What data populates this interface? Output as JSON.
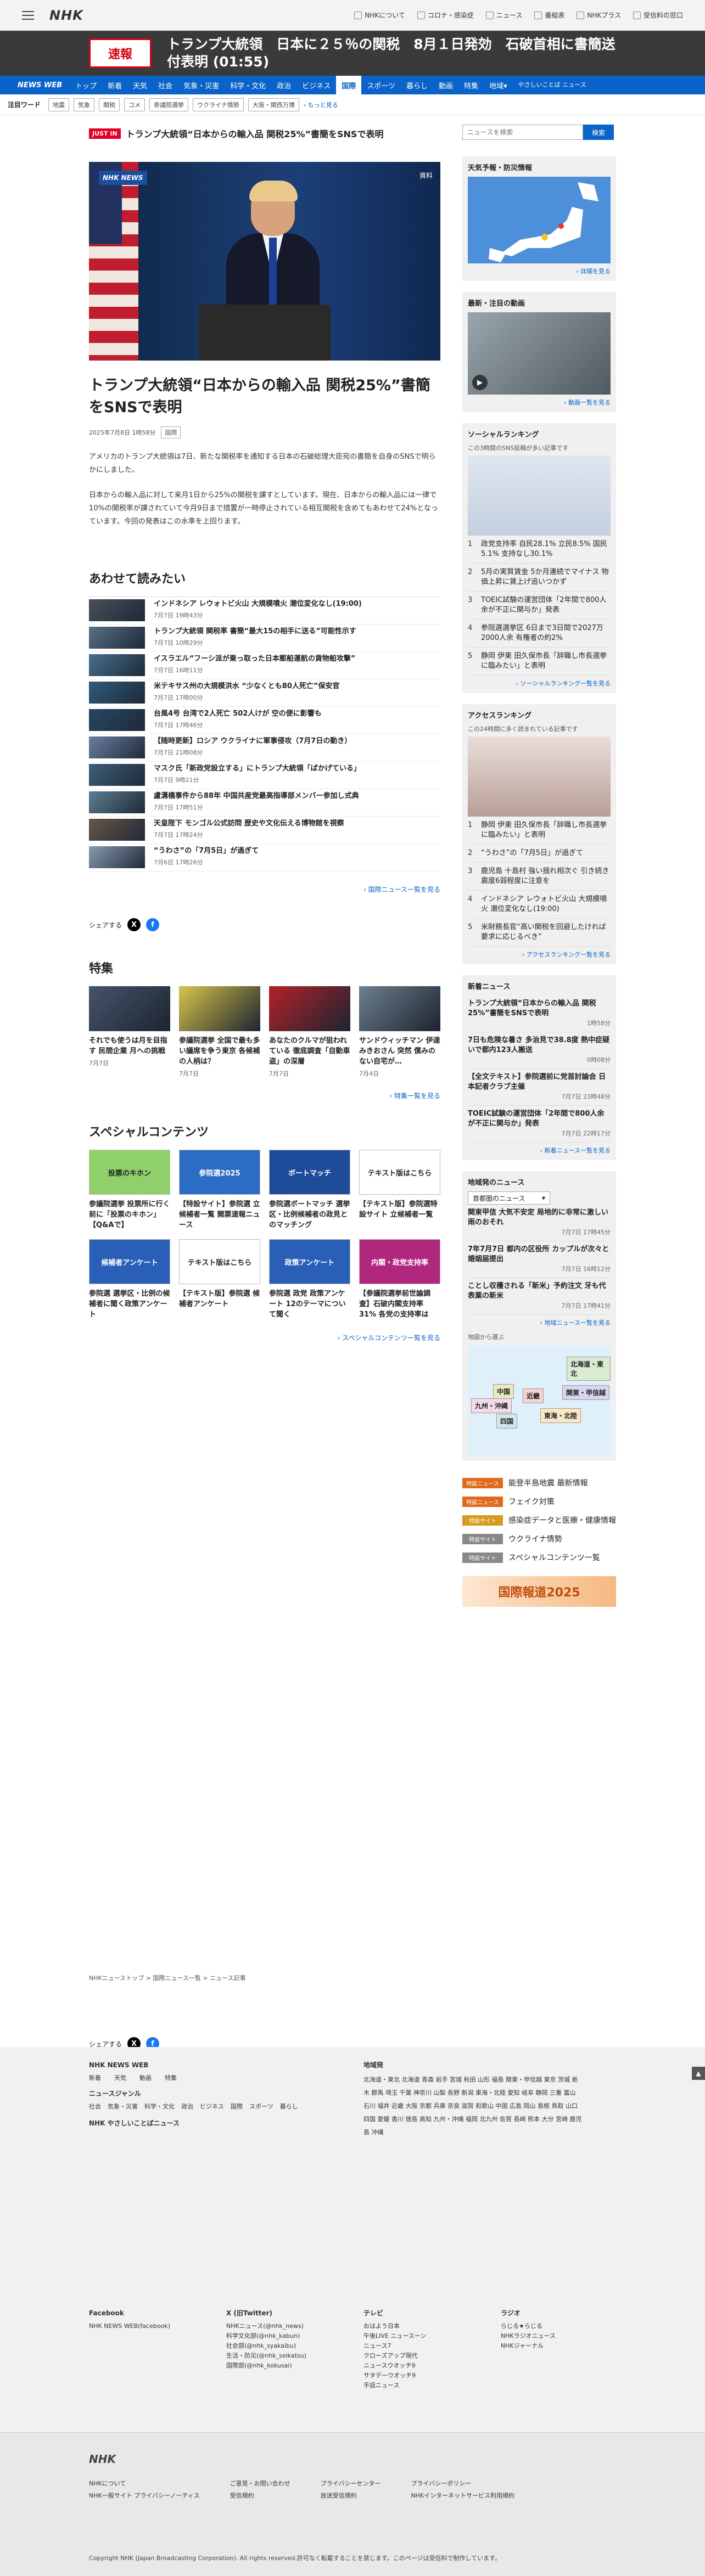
{
  "header": {
    "logo": "NHK",
    "links": [
      {
        "label": "NHKについて",
        "icon": "nhk-icon"
      },
      {
        "label": "コロナ・感染症",
        "icon": "virus-icon"
      },
      {
        "label": "ニュース",
        "icon": "news-icon"
      },
      {
        "label": "番組表",
        "icon": "tv-icon"
      },
      {
        "label": "NHKプラス",
        "icon": "play-icon"
      },
      {
        "label": "受信料の窓口",
        "icon": "yen-icon"
      }
    ]
  },
  "breaking": {
    "badge": "速報",
    "text": "トランプ大統領　日本に２５％の関税　8月１日発効　石破首相に書簡送付表明 (01:55)"
  },
  "nav": {
    "brand": "NEWS WEB",
    "items": [
      "トップ",
      "新着",
      "天気",
      "社会",
      "気象・災害",
      "科学・文化",
      "政治",
      "ビジネス",
      "国際",
      "スポーツ",
      "暮らし",
      "動画",
      "特集",
      "地域"
    ],
    "active": "国際",
    "region_suffix": "▾",
    "easy": "やさしいことば ニュース"
  },
  "keywords": {
    "label": "注目ワード",
    "tags": [
      "地震",
      "気象",
      "関税",
      "コメ",
      "参議院選挙",
      "ウクライナ情勢",
      "大阪・関西万博"
    ],
    "more": "もっと見る"
  },
  "article": {
    "justin_badge": "JUST IN",
    "justin_text": "トランプ大統領“日本からの輸入品 関税25%”書簡をSNSで表明",
    "image_label": "資料",
    "nhk_badge": "NHK NEWS",
    "title": "トランプ大統領“日本からの輸入品 関税25%”書簡をSNSで表明",
    "datetime": "2025年7月8日 1時58分",
    "genre": "国際",
    "paragraphs": [
      "アメリカのトランプ大統領は7日、新たな関税率を通知する日本の石破総理大臣宛の書簡を自身のSNSで明らかにしました。",
      "日本からの輸入品に対して来月1日から25%の関税を課すとしています。現在、日本からの輸入品には一律で10%の関税率が課されていて今月9日まで措置が一時停止されている相互関税を含めてもあわせて24%となっています。今回の発表はこの水準を上回ります。"
    ]
  },
  "related": {
    "heading": "あわせて読みたい",
    "items": [
      {
        "title": "インドネシア レウォトビ火山 大規模噴火 潮位変化なし(19:00)",
        "date": "7月7日 19時43分"
      },
      {
        "title": "トランプ大統領 関税率 書簡“最大15の相手に送る”可能性示す",
        "date": "7月7日 10時29分"
      },
      {
        "title": "イスラエル“フーシ派が乗っ取った日本郵船運航の貨物船攻撃”",
        "date": "7月7日 16時11分"
      },
      {
        "title": "米テキサス州の大規模洪水 “少なくとも80人死亡”保安官",
        "date": "7月7日 17時00分"
      },
      {
        "title": "台風4号 台湾で2人死亡 502人けが 空の便に影響も",
        "date": "7月7日 17時46分"
      },
      {
        "title": "【随時更新】ロシア ウクライナに軍事侵攻（7月7日の動き）",
        "date": "7月7日 21時08分"
      },
      {
        "title": "マスク氏「新政党設立する」にトランプ大統領「ばかげている」",
        "date": "7月7日 9時21分"
      },
      {
        "title": "盧溝橋事件から88年 中国共産党最高指導部メンバー参加し式典",
        "date": "7月7日 17時51分"
      },
      {
        "title": "天皇陛下 モンゴル公式訪問 歴史や文化伝える博物館を視察",
        "date": "7月7日 17時24分"
      },
      {
        "title": "“うわさ”の「7月5日」が過ぎて",
        "date": "7月6日 17時26分"
      }
    ],
    "more": "国際ニュース一覧を見る"
  },
  "share": {
    "label": "シェアする"
  },
  "features": {
    "heading": "特集",
    "items": [
      {
        "title": "それでも使うは月を目指す 民間企業 月への挑戦",
        "date": "7月7日"
      },
      {
        "title": "参議院選挙 全国で最も多い議席を争う東京 各候補の人柄は？",
        "date": "7月7日"
      },
      {
        "title": "あなたのクルマが狙われている 徹底調査「自動車盗」の深層",
        "date": "7月7日"
      },
      {
        "title": "サンドウィッチマン 伊達みきおさん 突然 僕みのない自宅が…",
        "date": "7月4日"
      }
    ],
    "more": "特集一覧を見る"
  },
  "special": {
    "heading": "スペシャルコンテンツ",
    "items": [
      {
        "title": "参議院選挙 投票所に行く前に「投票のキホン」【Q&Aで】",
        "img_text": "投票のキホン"
      },
      {
        "title": "【特設サイト】参院選 立候補者一覧 開票速報ニュース",
        "img_text": "参院選2025"
      },
      {
        "title": "参院選ボートマッチ 選挙区・比例候補者の政見とのマッチング",
        "img_text": "ボートマッチ"
      },
      {
        "title": "【テキスト版】参院選特設サイト 立候補者一覧",
        "img_text": "テキスト版はこちら"
      },
      {
        "title": "参院選 選挙区・比例の候補者に聞く政策アンケート",
        "img_text": "候補者アンケート"
      },
      {
        "title": "【テキスト版】参院選 候補者アンケート",
        "img_text": "テキスト版はこちら"
      },
      {
        "title": "参院選 政党 政策アンケート 12のテーマについて聞く",
        "img_text": "政策アンケート"
      },
      {
        "title": "【参議院選挙前世論調査】石破内閣支持率31% 各党の支持率は",
        "img_text": "内閣・政党支持率"
      }
    ],
    "more": "スペシャルコンテンツ一覧を見る"
  },
  "sidebar": {
    "search_placeholder": "ニュースを検索",
    "search_button": "検索",
    "weather": {
      "heading": "天気予報・防災情報",
      "link": "詳細を見る"
    },
    "video": {
      "heading": "最新・注目の動画",
      "link": "動画一覧を見る"
    },
    "social": {
      "heading": "ソーシャルランキング",
      "caption": "この3時間のSNS投稿が多い記事です",
      "items": [
        "政党支持率 自民28.1% 立民8.5% 国民5.1% 支持なし30.1%",
        "5月の実質賃金 5か月連続でマイナス 物価上昇に賃上げ追いつかず",
        "TOEIC試験の運営団体「2年間で800人余が不正に関与か」発表",
        "参院選選挙区 6日まで3日間で2027万2000人余 有権者の約2%",
        "静岡 伊東 田久保市長「辞職し市長選挙に臨みたい」と表明"
      ],
      "link": "ソーシャルランキング一覧を見る"
    },
    "access": {
      "heading": "アクセスランキング",
      "caption": "この24時間に多く読まれている記事です",
      "items": [
        "静岡 伊東 田久保市長「辞職し市長選挙に臨みたい」と表明",
        "“うわさ”の「7月5日」が過ぎて",
        "鹿児島 十島村 強い揺れ相次ぐ 引き続き震度6弱程度に注意を",
        "インドネシア レウォトビ火山 大規模噴火 潮位変化なし(19:00)",
        "米財務長官“高い関税を回避したければ要求に応じるべき”"
      ],
      "link": "アクセスランキング一覧を見る"
    },
    "latest": {
      "heading": "新着ニュース",
      "items": [
        {
          "title": "トランプ大統領“日本からの輸入品 関税25%”書簡をSNSで表明",
          "date": "1時58分"
        },
        {
          "title": "7日も危険な暑さ 多治見で38.8度 熱中症疑いで都内123人搬送",
          "date": "0時08分"
        },
        {
          "title": "【全文テキスト】参院選前に党首討論会 日本記者クラブ主催",
          "date": "7月7日 23時48分"
        },
        {
          "title": "TOEIC試験の運営団体「2年間で800人余が不正に関与か」発表",
          "date": "7月7日 22時17分"
        }
      ],
      "link": "新着ニュース一覧を見る"
    },
    "local": {
      "heading": "地域発のニュース",
      "region": "首都圏のニュース",
      "items": [
        {
          "title": "関東甲信 大気不安定 局地的に非常に激しい雨のおそれ",
          "date": "7月7日 17時45分"
        },
        {
          "title": "7年7月7日 都内の区役所 カップルが次々と婚姻届提出",
          "date": "7月7日 16時12分"
        },
        {
          "title": "ことし収穫される「新米」予約注文 牙も代表業の新米",
          "date": "7月7日 17時41分"
        }
      ],
      "link": "地域ニュース一覧を見る",
      "map_caption": "地図から選ぶ",
      "regions": [
        "北海道・東北",
        "関東・甲信越",
        "東海・北陸",
        "近畿",
        "中国",
        "四国",
        "九州・沖縄"
      ]
    },
    "tags": [
      {
        "badge": "特設ニュース",
        "label": "能登半島地震 最新情報",
        "color": "#e06a1c"
      },
      {
        "badge": "特設ニュース",
        "label": "フェイク対策",
        "color": "#e06a1c"
      },
      {
        "badge": "特設サイト",
        "label": "感染症データと医療・健康情報",
        "color": "#d69b1e"
      },
      {
        "badge": "特設サイト",
        "label": "ウクライナ情勢",
        "color": "#888888"
      },
      {
        "badge": "特設サイト",
        "label": "スペシャルコンテンツ一覧",
        "color": "#888888"
      }
    ],
    "banner": "国際報道2025"
  },
  "breadcrumbs": [
    "NHKニューストップ",
    "国際ニュース一覧",
    "ニュース記事"
  ],
  "footer": {
    "brand": "NHK NEWS WEB",
    "main_links": [
      "新着",
      "天気",
      "動画",
      "特集"
    ],
    "genre_heading": "ニュースジャンル",
    "genres": [
      "社会",
      "気象・災害",
      "科学・文化",
      "政治",
      "ビジネス",
      "国際",
      "スポーツ",
      "暮らし"
    ],
    "easy": "NHK やさしいことばニュース",
    "region_heading": "地域発",
    "regions": "北海道・東北 北海道 青森 岩手 宮城 秋田 山形 福島 関東・甲信越 東京 茨城 栃木 群馬 埼玉 千葉 神奈川 山梨 長野 新潟 東海・北陸 愛知 岐阜 静岡 三重 富山 石川 福井 近畿 大阪 京都 兵庫 奈良 滋賀 和歌山 中国 広島 岡山 島根 鳥取 山口 四国 愛媛 香川 徳島 高知 九州・沖縄 福岡 北九州 佐賀 長崎 熊本 大分 宮崎 鹿児島 沖縄",
    "sns": [
      {
        "heading": "Facebook",
        "lines": [
          "NHK NEWS WEB(facebook)"
        ]
      },
      {
        "heading": "X (旧Twitter)",
        "lines": [
          "NHKニュース(@nhk_news)",
          "科学文化部(@nhk_kabun)",
          "社会部(@nhk_syakaibu)",
          "生活・防災(@nhk_seikatsu)",
          "国際部(@nhk_kokusai)"
        ]
      },
      {
        "heading": "テレビ",
        "lines": [
          "おはよう日本",
          "午後LIVE ニュースーン",
          "ニュース7",
          "クローズアップ現代",
          "ニュースウオッチ9",
          "サタデーウオッチ9",
          "手話ニュース"
        ]
      },
      {
        "heading": "ラジオ",
        "lines": [
          "らじる★らじる",
          "NHKラジオニュース",
          "NHKジャーナル"
        ]
      }
    ],
    "bottom_logo": "NHK",
    "bottom_links": [
      "NHKについて",
      "ご意見・お問い合わせ",
      "プライバシーセンター",
      "プライバシーポリシー",
      "NHK一般サイト プライバシーノーティス",
      "受信規約",
      "放送受信規約",
      "NHKインターネットサービス利用規約"
    ],
    "copyright": "Copyright NHK (Japan Broadcasting Corporation). All rights reserved.許可なく転載することを禁じます。このページは受信料で制作しています。"
  }
}
